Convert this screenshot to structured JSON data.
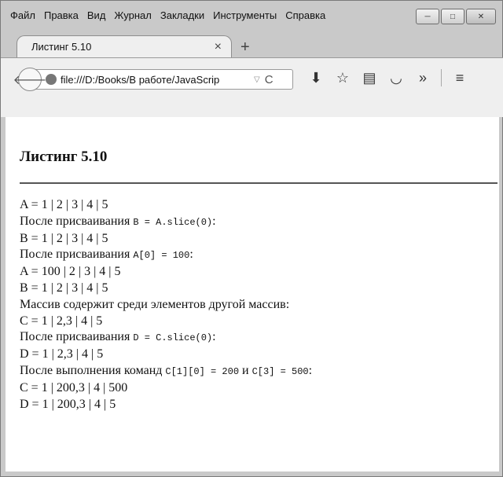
{
  "menubar": {
    "items": [
      "Файл",
      "Правка",
      "Вид",
      "Журнал",
      "Закладки",
      "Инструменты",
      "Справка"
    ]
  },
  "window_controls": {
    "minimize": "─",
    "maximize": "□",
    "close": "✕"
  },
  "tab": {
    "title": "Листинг 5.10",
    "close": "×",
    "new_tab": "+"
  },
  "address": {
    "url": "file:///D:/Books/В работе/JavaScrip"
  },
  "icons": {
    "back": "arrow-left-icon",
    "site": "globe-icon",
    "dropdown": "chevron-down-icon",
    "reload": "reload-icon",
    "download": "download-icon",
    "bookmark": "star-icon",
    "reader": "reader-list-icon",
    "pocket": "pocket-icon",
    "overflow": "chevrons-right-icon",
    "menu": "hamburger-menu-icon"
  },
  "page": {
    "heading": "Листинг 5.10",
    "lines": [
      {
        "text": "A = 1 | 2 | 3 | 4 | 5"
      },
      {
        "text": "После присваивания ",
        "code": "B = A.slice(0)",
        "tail": ":"
      },
      {
        "text": "B = 1 | 2 | 3 | 4 | 5"
      },
      {
        "text": "После присваивания ",
        "code": "A[0] = 100",
        "tail": ":"
      },
      {
        "text": "A = 100 | 2 | 3 | 4 | 5"
      },
      {
        "text": "B = 1 | 2 | 3 | 4 | 5"
      },
      {
        "text": "Массив содержит среди элементов другой массив:"
      },
      {
        "text": "C = 1 | 2,3 | 4 | 5"
      },
      {
        "text": "После присваивания ",
        "code": "D = C.slice(0)",
        "tail": ":"
      },
      {
        "text": "D = 1 | 2,3 | 4 | 5"
      },
      {
        "text": "После выполнения команд ",
        "code": "C[1][0] = 200",
        "mid": " и ",
        "code2": "C[3] = 500",
        "tail": ":"
      },
      {
        "text": "C = 1 | 200,3 | 4 | 500"
      },
      {
        "text": "D = 1 | 200,3 | 4 | 5"
      }
    ]
  }
}
